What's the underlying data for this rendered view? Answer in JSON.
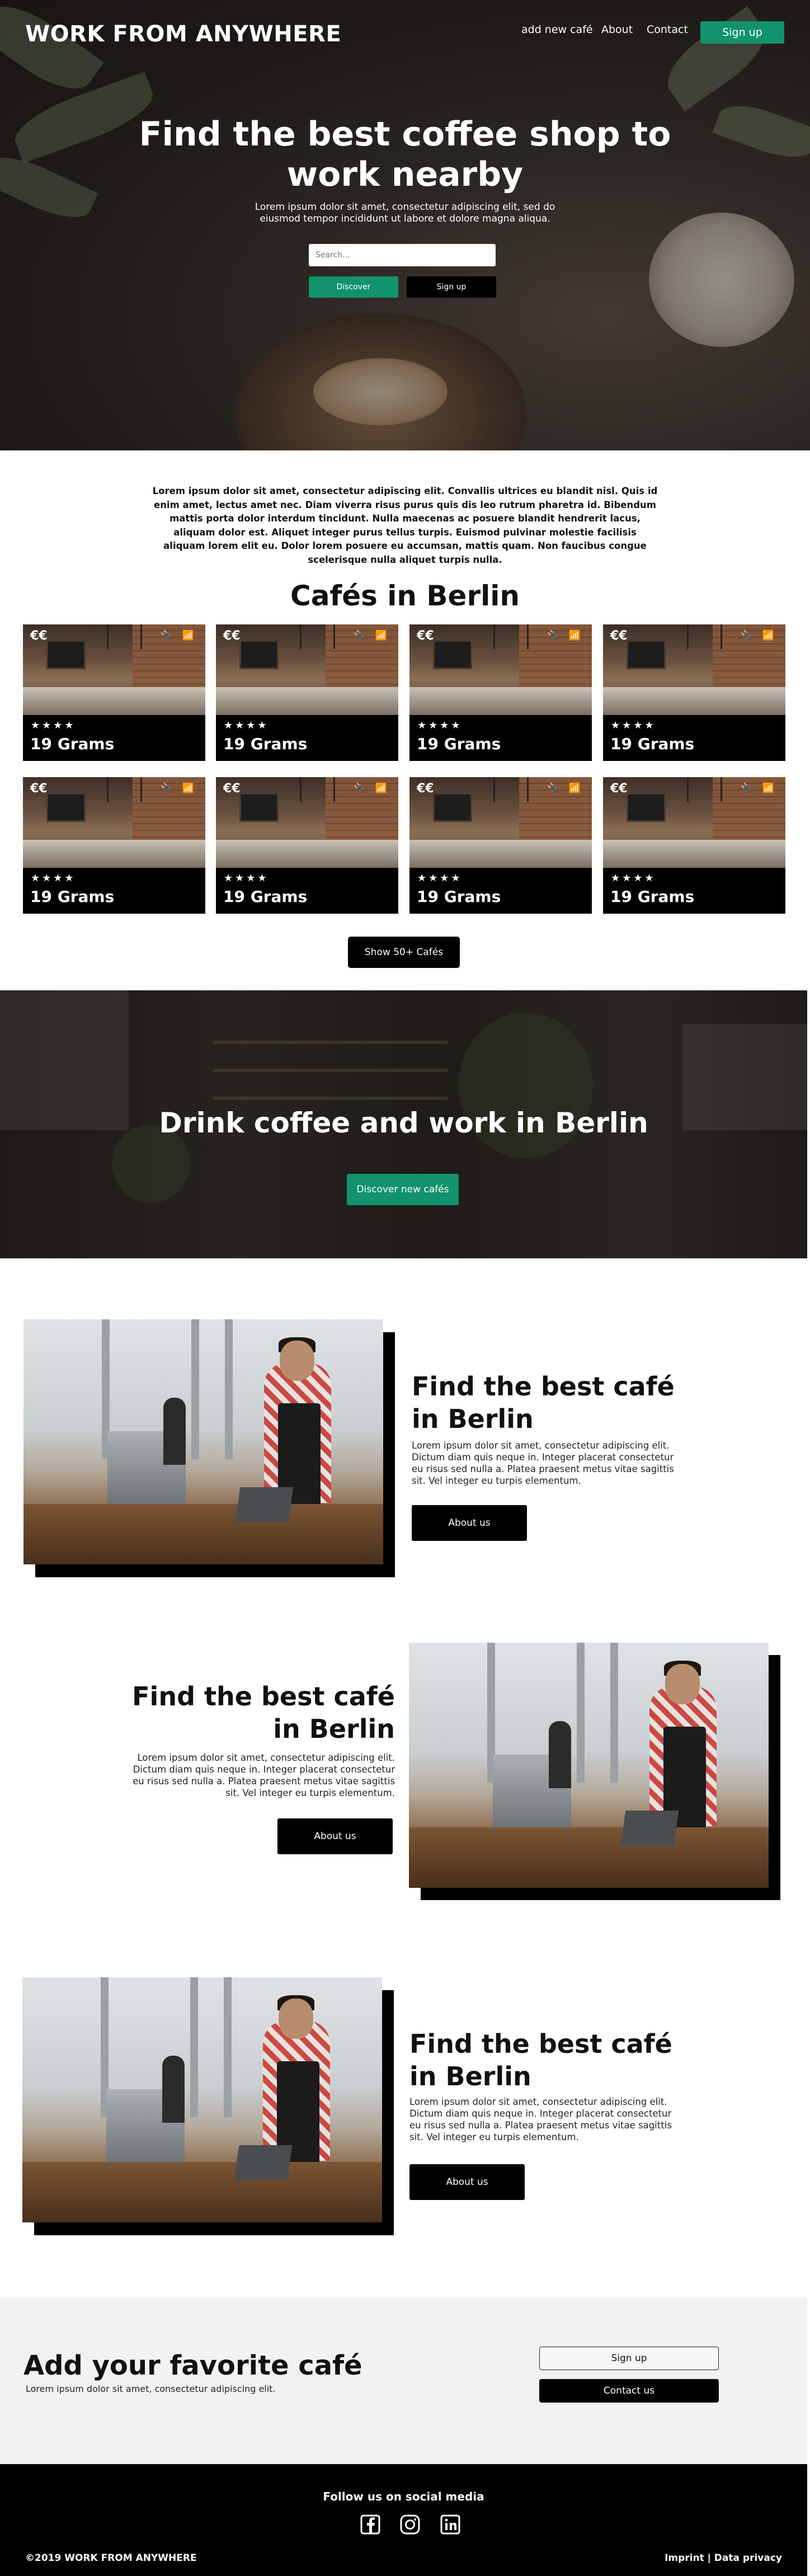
{
  "header": {
    "brand": "WORK FROM ANYWHERE",
    "nav": [
      "add new café",
      "About",
      "Contact"
    ],
    "signup_label": "Sign up"
  },
  "hero": {
    "title": "Find the best coffee shop to work nearby",
    "subtitle": "Lorem ipsum dolor sit amet, consectetur adipiscing elit, sed do eiusmod tempor incididunt ut labore et dolore magna aliqua.",
    "search_placeholder": "Search...",
    "discover_label": "Discover",
    "signup_label": "Sign up"
  },
  "intro": {
    "text": "Lorem ipsum dolor sit amet, consectetur adipiscing elit. Convallis ultrices eu blandit nisl. Quis id enim amet, lectus amet nec. Diam viverra risus purus quis dis leo rutrum pharetra id. Bibendum mattis porta dolor interdum tincidunt. Nulla maecenas ac posuere blandit hendrerit lacus, aliquam dolor est. Aliquet integer purus tellus turpis. Euismod pulvinar molestie facilisis aliquam lorem elit eu. Dolor lorem posuere eu accumsan, mattis quam. Non faucibus congue scelerisque nulla aliquet turpis nulla."
  },
  "cafes": {
    "title": "Cafés in Berlin",
    "cards": [
      {
        "name": "19 Grams",
        "price": "€€",
        "stars": "★★★★",
        "amenities": "🔌 📶"
      },
      {
        "name": "19 Grams",
        "price": "€€",
        "stars": "★★★★",
        "amenities": "🔌 📶"
      },
      {
        "name": "19 Grams",
        "price": "€€",
        "stars": "★★★★",
        "amenities": "🔌 📶"
      },
      {
        "name": "19 Grams",
        "price": "€€",
        "stars": "★★★★",
        "amenities": "🔌 📶"
      },
      {
        "name": "19 Grams",
        "price": "€€",
        "stars": "★★★★",
        "amenities": "🔌 📶"
      },
      {
        "name": "19 Grams",
        "price": "€€",
        "stars": "★★★★",
        "amenities": "🔌 📶"
      },
      {
        "name": "19 Grams",
        "price": "€€",
        "stars": "★★★★",
        "amenities": "🔌 📶"
      },
      {
        "name": "19 Grams",
        "price": "€€",
        "stars": "★★★★",
        "amenities": "🔌 📶"
      }
    ],
    "show_more_label": "Show 50+ Cafés"
  },
  "banner": {
    "title": "Drink coffee and work in Berlin",
    "button_label": "Discover new cafés"
  },
  "features": [
    {
      "title_line1": "Find the best café",
      "title_line2": "in Berlin",
      "text": "Lorem ipsum dolor sit amet, consectetur adipiscing elit. Dictum diam quis neque in. Integer placerat consectetur eu risus sed nulla a. Platea praesent metus vitae sagittis sit. Vel integer eu turpis elementum.",
      "button_label": "About us"
    },
    {
      "title_line1": "Find the best café",
      "title_line2": "in Berlin",
      "text": "Lorem ipsum dolor sit amet, consectetur adipiscing elit. Dictum diam quis neque in. Integer placerat consectetur eu risus sed nulla a. Platea praesent metus vitae sagittis sit. Vel integer eu turpis elementum.",
      "button_label": "About us"
    },
    {
      "title_line1": "Find the best café",
      "title_line2": "in Berlin",
      "text": "Lorem ipsum dolor sit amet, consectetur adipiscing elit. Dictum diam quis neque in. Integer placerat consectetur eu risus sed nulla a. Platea praesent metus vitae sagittis sit. Vel integer eu turpis elementum.",
      "button_label": "About us"
    }
  ],
  "cta": {
    "title": "Add your favorite café",
    "subtitle": "Lorem ipsum dolor sit amet, consectetur adipiscing elit.",
    "signup_label": "Sign up",
    "contact_label": "Contact us"
  },
  "footer": {
    "follow": "Follow us on social media",
    "social": [
      "facebook-icon",
      "instagram-icon",
      "linkedin-icon"
    ],
    "copyright": "©2019 WORK FROM ANYWHERE",
    "legal": "Imprint | Data privacy"
  },
  "colors": {
    "accent": "#12936b",
    "dark": "#000000",
    "cta_bg": "#f2f2f2"
  }
}
